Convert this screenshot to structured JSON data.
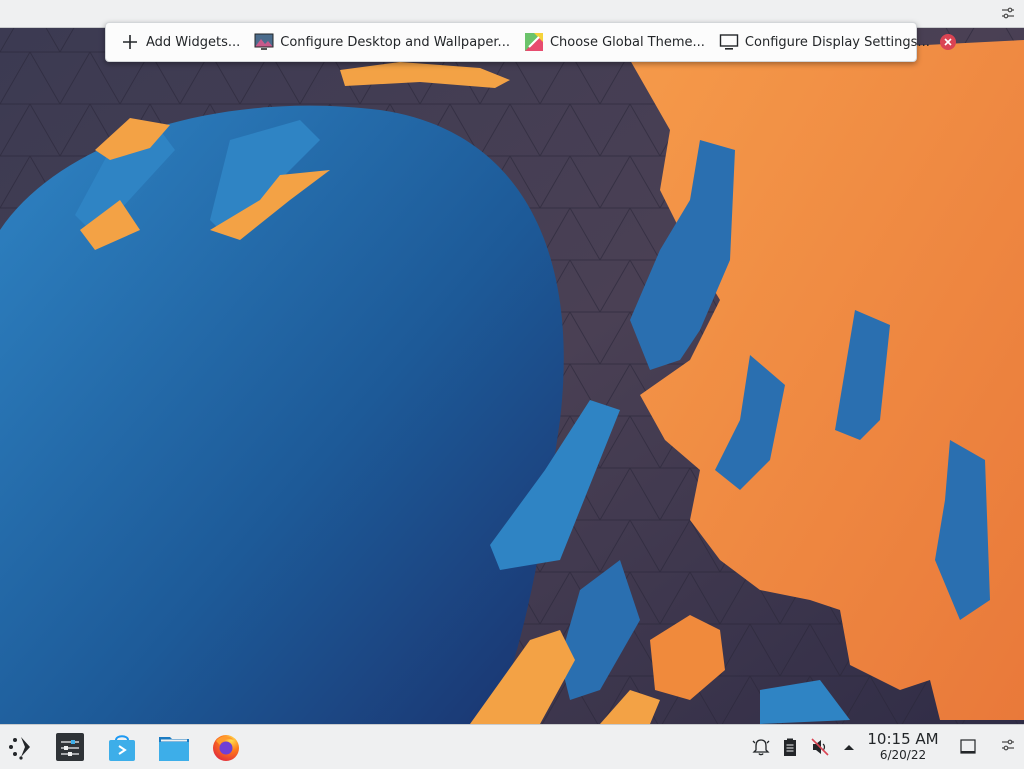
{
  "desktop": {
    "toolbox": {
      "items": [
        {
          "label": "Add Widgets...",
          "icon": "plus-icon"
        },
        {
          "label": "Configure Desktop and Wallpaper...",
          "icon": "desktop-wallpaper-icon"
        },
        {
          "label": "Choose Global Theme...",
          "icon": "global-theme-icon"
        },
        {
          "label": "Configure Display Settings...",
          "icon": "monitor-icon"
        }
      ],
      "close_icon": "close-icon"
    },
    "top_panel": {
      "settings_icon": "panel-settings-icon"
    }
  },
  "taskbar": {
    "launchers": [
      {
        "name": "application-launcher",
        "icon": "kde-launcher-icon"
      },
      {
        "name": "system-settings",
        "icon": "system-settings-icon"
      },
      {
        "name": "discover",
        "icon": "discover-store-icon"
      },
      {
        "name": "dolphin",
        "icon": "folder-icon"
      },
      {
        "name": "firefox",
        "icon": "firefox-icon"
      }
    ],
    "tray": [
      {
        "name": "notifications",
        "icon": "bell-icon"
      },
      {
        "name": "clipboard",
        "icon": "clipboard-icon"
      },
      {
        "name": "volume",
        "icon": "volume-muted-icon"
      },
      {
        "name": "show-hidden",
        "icon": "arrow-up-icon"
      }
    ],
    "clock": {
      "time": "10:15 AM",
      "date": "6/20/22"
    },
    "show_desktop_icon": "show-desktop-icon",
    "panel_settings_icon": "panel-settings-icon"
  },
  "colors": {
    "panel_bg": "#eff0f1",
    "accent": "#3daee9",
    "close_red": "#da4453",
    "wallpaper_orange": "#f08a3c",
    "wallpaper_blue": "#1d5fa0"
  }
}
